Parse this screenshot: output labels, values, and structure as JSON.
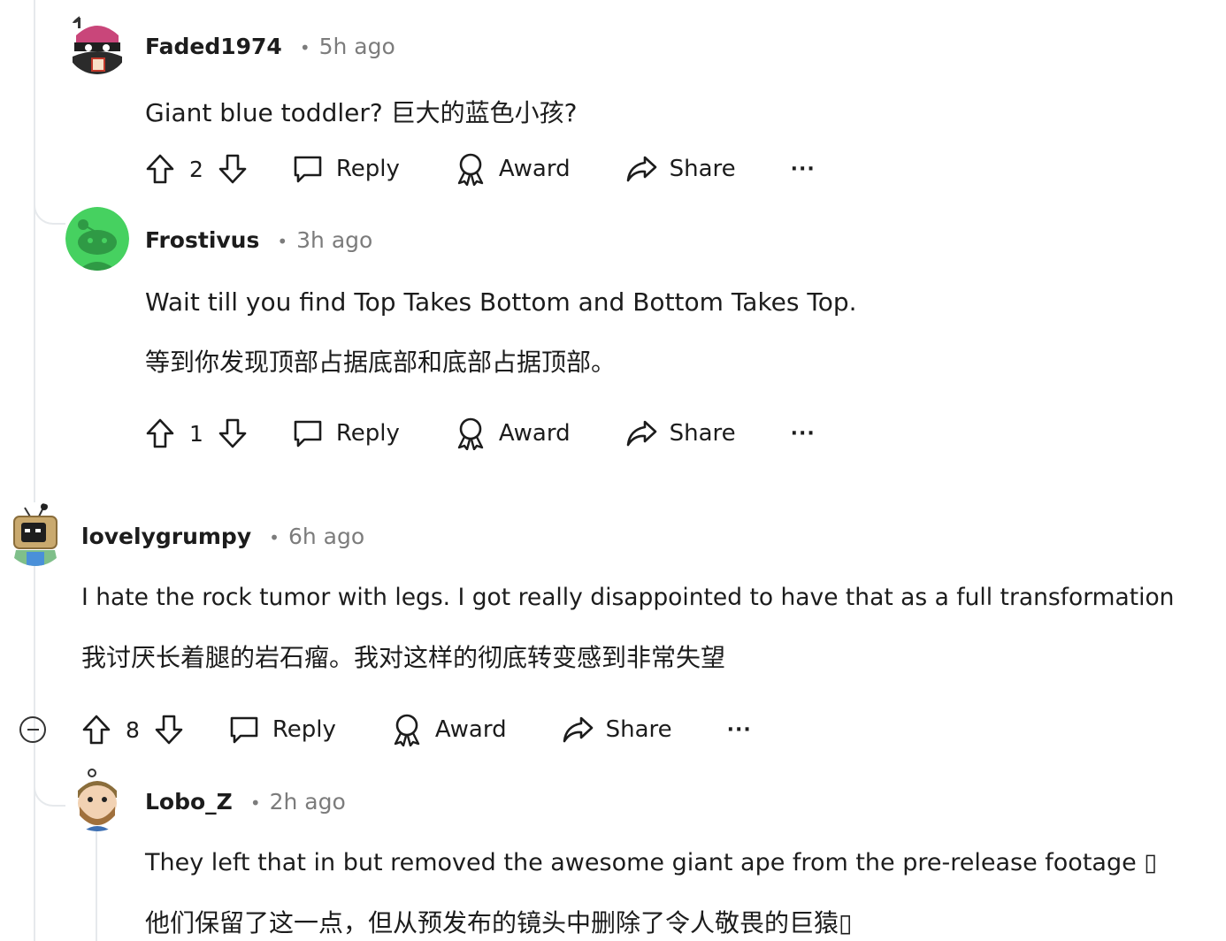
{
  "comments": [
    {
      "username": "Faded1974",
      "time": "5h ago",
      "dot": "•",
      "lines": [
        "Giant blue toddler?  巨大的蓝色小孩?"
      ],
      "votes": "2",
      "reply": "Reply",
      "award": "Award",
      "share": "Share",
      "more": "···",
      "avatar": "robot-avatar-icon"
    },
    {
      "username": "Frostivus",
      "time": "3h ago",
      "dot": "•",
      "lines": [
        "Wait till you find Top Takes Bottom and Bottom Takes Top.",
        "等到你发现顶部占据底部和底部占据顶部。"
      ],
      "votes": "1",
      "reply": "Reply",
      "award": "Award",
      "share": "Share",
      "more": "···",
      "avatar": "snoo-avatar-icon"
    },
    {
      "username": "lovelygrumpy",
      "time": "6h ago",
      "dot": "•",
      "lines": [
        "I hate the rock tumor with legs. I got really disappointed to have that as a full transformation",
        "我讨厌长着腿的岩石瘤。我对这样的彻底转变感到非常失望"
      ],
      "votes": "8",
      "reply": "Reply",
      "award": "Award",
      "share": "Share",
      "more": "···",
      "avatar": "tv-head-avatar-icon"
    },
    {
      "username": "Lobo_Z",
      "time": "2h ago",
      "dot": "•",
      "lines": [
        "They left that in but removed the awesome giant ape from the pre-release footage ▯",
        "他们保留了这一点，但从预发布的镜头中删除了令人敬畏的巨猿▯"
      ],
      "avatar": "bearded-avatar-icon"
    }
  ],
  "colors": {
    "text": "#1c1c1c",
    "meta": "#7c7c7c",
    "thread": "#e6e9ec",
    "snoo_green": "#46d160"
  }
}
